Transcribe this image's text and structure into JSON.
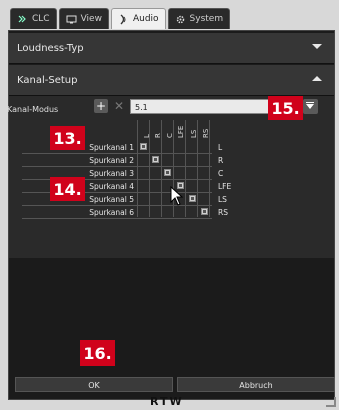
{
  "tabs": [
    {
      "label": "CLC",
      "icon": "clc-icon",
      "active": false
    },
    {
      "label": "View",
      "icon": "monitor-icon",
      "active": false
    },
    {
      "label": "Audio",
      "icon": "audio-icon",
      "active": true
    },
    {
      "label": "System",
      "icon": "gear-icon",
      "active": false
    }
  ],
  "sections": {
    "loudness": {
      "title": "Loudness-Typ",
      "expanded": false
    },
    "kanal_setup": {
      "title": "Kanal-Setup",
      "expanded": true
    }
  },
  "kanal_modus": {
    "label": "Kanal-Modus",
    "value": "5.1"
  },
  "matrix": {
    "input_channels": [
      "Spurkanal 1",
      "Spurkanal 2",
      "Spurkanal 3",
      "Spurkanal 4",
      "Spurkanal 5",
      "Spurkanal 6"
    ],
    "output_columns": [
      "L",
      "R",
      "C",
      "LFE",
      "LS",
      "RS"
    ],
    "row_outputs": [
      "L",
      "R",
      "C",
      "LFE",
      "LS",
      "RS"
    ],
    "assignments": [
      0,
      1,
      2,
      3,
      4,
      5
    ]
  },
  "callouts": {
    "c13": "13.",
    "c14": "14.",
    "c15": "15.",
    "c16": "16."
  },
  "buttons": {
    "ok": "OK",
    "cancel": "Abbruch"
  },
  "brand": "RTW",
  "colors": {
    "callout": "#d0021b",
    "panel": "#1b1b1b"
  }
}
